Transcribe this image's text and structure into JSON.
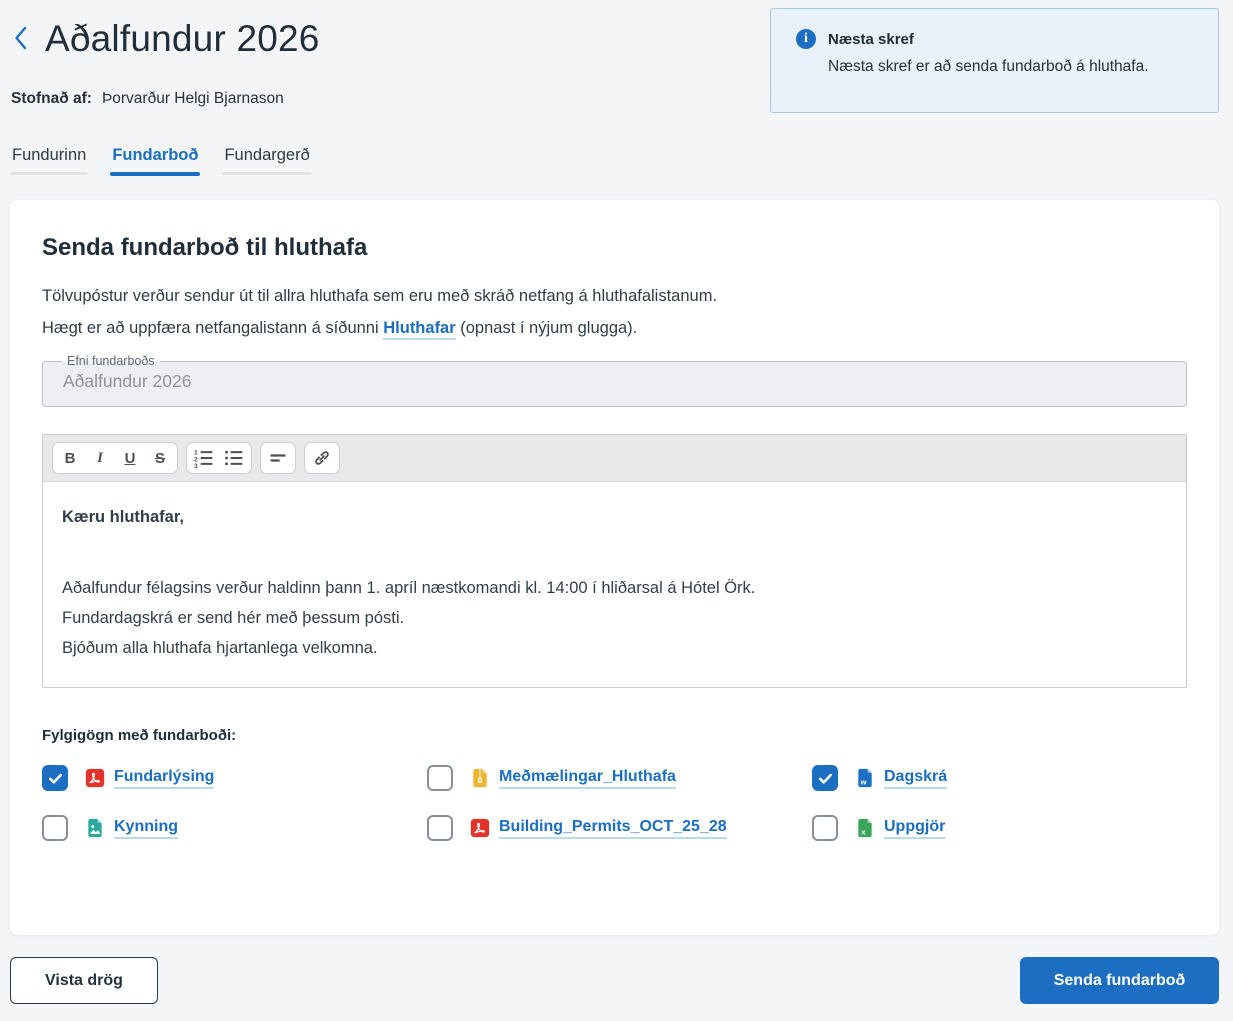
{
  "header": {
    "title": "Aðalfundur 2026",
    "created_by_label": "Stofnað af:",
    "created_by_value": "Þorvarður Helgi Bjarnason"
  },
  "info_box": {
    "title": "Næsta skref",
    "text": "Næsta skref er að senda fundarboð á hluthafa."
  },
  "tabs": [
    {
      "label": "Fundurinn",
      "active": false
    },
    {
      "label": "Fundarboð",
      "active": true
    },
    {
      "label": "Fundargerð",
      "active": false
    }
  ],
  "card": {
    "title": "Senda fundarboð til hluthafa",
    "paragraph1": "Tölvupóstur verður sendur út til allra hluthafa sem eru með skráð netfang á hluthafalistanum.",
    "paragraph2_prefix": "Hægt er að uppfæra netfangalistann á síðunni ",
    "paragraph2_link": "Hluthafar",
    "paragraph2_suffix": " (opnast í nýjum glugga).",
    "subject_field": {
      "label": "Efni fundarboðs",
      "value": "Aðalfundur 2026"
    },
    "editor": {
      "toolbar_groups": [
        [
          {
            "name": "bold-button",
            "glyph": "B",
            "style": "g-bold"
          },
          {
            "name": "italic-button",
            "glyph": "I",
            "style": "g-italic"
          },
          {
            "name": "underline-button",
            "glyph": "U",
            "style": "g-underline"
          },
          {
            "name": "strikethrough-button",
            "glyph": "S",
            "style": "g-strike"
          }
        ],
        [
          {
            "name": "ordered-list-button",
            "icon": "ordered-list"
          },
          {
            "name": "bullet-list-button",
            "icon": "bullet-list"
          }
        ],
        [
          {
            "name": "align-left-button",
            "icon": "align-left"
          }
        ],
        [
          {
            "name": "link-button",
            "icon": "link"
          }
        ]
      ],
      "greeting": "Kæru hluthafar,",
      "lines": [
        "Aðalfundur félagsins verður haldinn þann 1. apríl næstkomandi kl. 14:00 í hliðarsal á Hótel Örk.",
        "Fundardagskrá er send hér með þessum pósti.",
        "Bjóðum alla hluthafa hjartanlega velkomna."
      ]
    },
    "attachments": {
      "label": "Fylgigögn með fundarboði:",
      "items": [
        {
          "name": "Fundarlýsing",
          "type": "pdf",
          "checked": true
        },
        {
          "name": "Meðmælingar_Hluthafa",
          "type": "zip",
          "checked": false
        },
        {
          "name": "Dagskrá",
          "type": "word",
          "checked": true
        },
        {
          "name": "Kynning",
          "type": "image",
          "checked": false
        },
        {
          "name": "Building_Permits_OCT_25_28",
          "type": "pdf",
          "checked": false
        },
        {
          "name": "Uppgjör",
          "type": "excel",
          "checked": false
        }
      ]
    }
  },
  "footer": {
    "save_draft_label": "Vista drög",
    "send_label": "Senda fundarboð"
  },
  "colors": {
    "accent_blue": "#1b6ec2",
    "info_box_bg": "#e9f1fb",
    "info_box_border": "#a9c7e7",
    "pdf_red": "#e2342c",
    "zip_yellow": "#f0b32e",
    "image_teal": "#2aa9a0",
    "word_blue": "#1b6ec2",
    "excel_green": "#3ba55b"
  }
}
